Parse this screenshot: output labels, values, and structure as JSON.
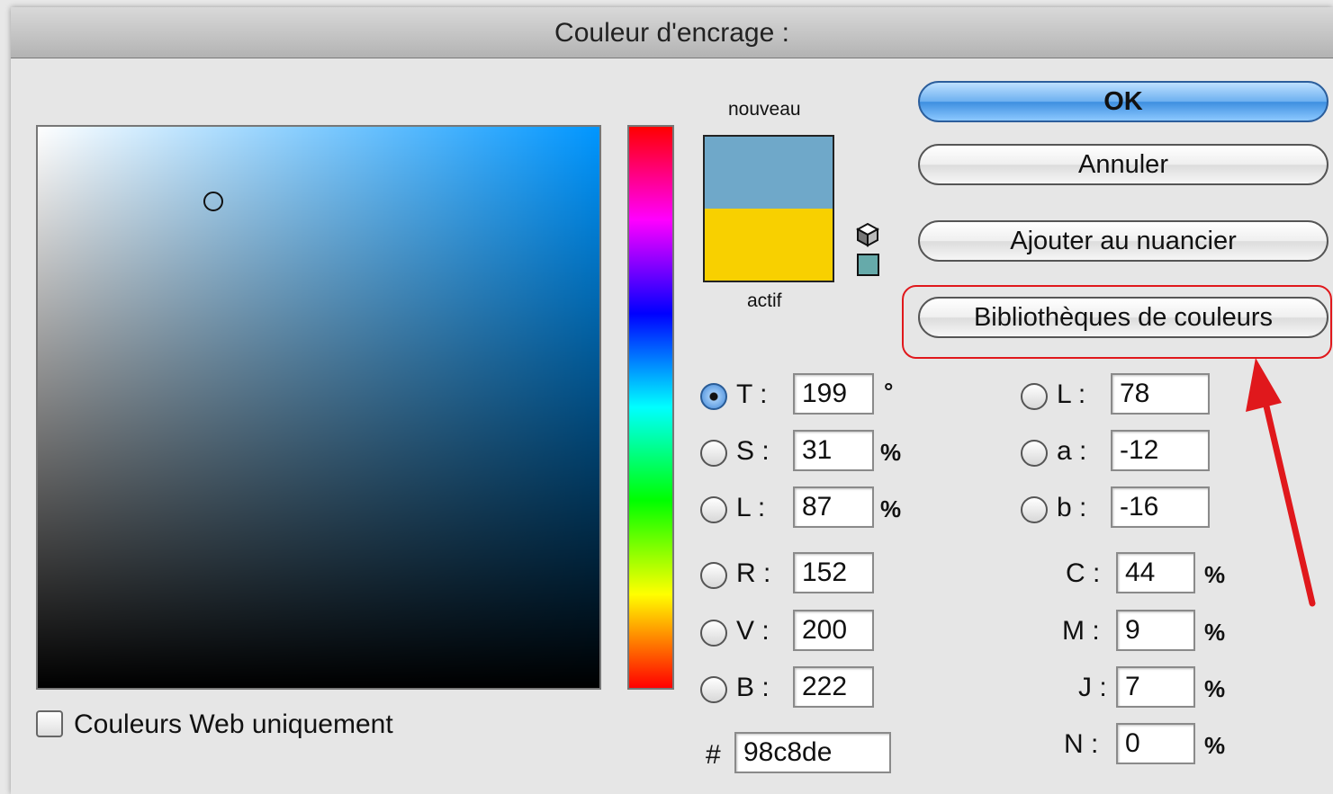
{
  "dialog": {
    "title": "Couleur d'encrage :"
  },
  "swatch": {
    "new_label": "nouveau",
    "current_label": "actif",
    "new_color": "#6fa8c9",
    "current_color": "#f8d000",
    "websafe_color": "#66aaaa"
  },
  "buttons": {
    "ok": "OK",
    "cancel": "Annuler",
    "add_swatch": "Ajouter au nuancier",
    "color_libraries": "Bibliothèques de couleurs"
  },
  "hsb": {
    "h": {
      "label": "T :",
      "value": "199",
      "unit": "°"
    },
    "s": {
      "label": "S :",
      "value": "31",
      "unit": "%"
    },
    "b": {
      "label": "L :",
      "value": "87",
      "unit": "%"
    }
  },
  "rgb": {
    "r": {
      "label": "R :",
      "value": "152"
    },
    "g": {
      "label": "V :",
      "value": "200"
    },
    "b": {
      "label": "B :",
      "value": "222"
    }
  },
  "lab": {
    "l": {
      "label": "L :",
      "value": "78"
    },
    "a": {
      "label": "a :",
      "value": "-12"
    },
    "b": {
      "label": "b :",
      "value": "-16"
    }
  },
  "cmyk": {
    "c": {
      "label": "C :",
      "value": "44",
      "unit": "%"
    },
    "m": {
      "label": "M :",
      "value": "9",
      "unit": "%"
    },
    "y": {
      "label": "J :",
      "value": "7",
      "unit": "%"
    },
    "k": {
      "label": "N :",
      "value": "0",
      "unit": "%"
    }
  },
  "hex": {
    "label": "#",
    "value": "98c8de"
  },
  "web_only": {
    "label": "Couleurs Web uniquement"
  },
  "annotation": {
    "color": "#e0181c"
  }
}
